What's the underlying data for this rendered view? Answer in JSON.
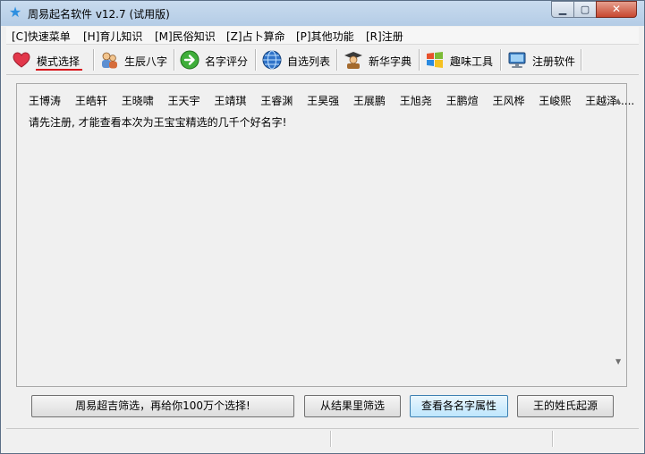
{
  "window": {
    "title": "周易起名软件 v12.7 (试用版)",
    "icons": {
      "app": "star-icon",
      "minimize": "minimize-icon",
      "maximize": "maximize-icon",
      "close": "close-icon"
    }
  },
  "menu": [
    {
      "label": "[C]快速菜单"
    },
    {
      "label": "[H]育儿知识"
    },
    {
      "label": "[M]民俗知识"
    },
    {
      "label": "[Z]占卜算命"
    },
    {
      "label": "[P]其他功能"
    },
    {
      "label": "[R]注册"
    }
  ],
  "toolbar": [
    {
      "label": "模式选择",
      "icon": "heart-icon"
    },
    {
      "label": "生辰八字",
      "icon": "people-icon"
    },
    {
      "label": "名字评分",
      "icon": "arrow-right-icon"
    },
    {
      "label": "自选列表",
      "icon": "globe-icon"
    },
    {
      "label": "新华字典",
      "icon": "scholar-icon"
    },
    {
      "label": "趣味工具",
      "icon": "windows-logo-icon"
    },
    {
      "label": "注册软件",
      "icon": "monitor-icon"
    }
  ],
  "content": {
    "names": [
      "王博涛",
      "王皓轩",
      "王晓啸",
      "王天宇",
      "王靖琪",
      "王睿渊",
      "王昊强",
      "王展鹏",
      "王旭尧",
      "王鹏煊",
      "王风桦",
      "王峻熙",
      "王越泽....."
    ],
    "notice": "请先注册, 才能查看本次为王宝宝精选的几千个好名字!"
  },
  "buttons": [
    {
      "label": "周易超吉筛选，再给你100万个选择!"
    },
    {
      "label": "从结果里筛选"
    },
    {
      "label": "查看各名字属性"
    },
    {
      "label": "王的姓氏起源"
    }
  ],
  "colors": {
    "accent_underline": "#d8141b",
    "title_bar": "#c8dbee",
    "close_button": "#c7472f"
  }
}
